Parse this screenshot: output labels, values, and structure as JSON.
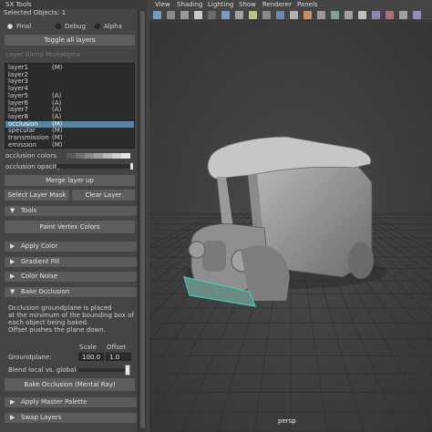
{
  "window": {
    "title": "SX Tools",
    "selected_objects": "Selected Objects: 1"
  },
  "shading_mode": {
    "options": [
      "Final",
      "Debug",
      "Alpha"
    ],
    "selected": "Final"
  },
  "toggle_all_layers": "Toggle all layers",
  "layer_blend_mode": {
    "label": "Layer Blend Mode",
    "value": "Alpha"
  },
  "layers": [
    {
      "name": "layer1",
      "flag": "(M)"
    },
    {
      "name": "layer2",
      "flag": ""
    },
    {
      "name": "layer3",
      "flag": ""
    },
    {
      "name": "layer4",
      "flag": ""
    },
    {
      "name": "layer5",
      "flag": "(A)"
    },
    {
      "name": "layer6",
      "flag": "(A)"
    },
    {
      "name": "layer7",
      "flag": "(A)"
    },
    {
      "name": "layer8",
      "flag": "(A)"
    },
    {
      "name": "occlusion",
      "flag": "(M)"
    },
    {
      "name": "specular",
      "flag": "(M)"
    },
    {
      "name": "transmission",
      "flag": "(M)"
    },
    {
      "name": "emission",
      "flag": "(M)"
    }
  ],
  "selected_layer": "occlusion",
  "occlusion_colors": {
    "label": "occlusion colors:",
    "swatches": [
      "#444444",
      "#5a5a5a",
      "#707070",
      "#888888",
      "#a0a0a0",
      "#b8b8b8",
      "#d0d0d0",
      "#e8e8e8"
    ]
  },
  "occlusion_opacity": {
    "label": "occlusion opacity:",
    "value": 1.0
  },
  "buttons": {
    "merge_layer_up": "Merge layer up",
    "select_layer_mask": "Select Layer Mask",
    "clear_layer": "Clear Layer",
    "paint_vertex_colors": "Paint Vertex Colors",
    "bake_occlusion": "Bake Occlusion (Mental Ray)"
  },
  "sections": {
    "tools": "Tools",
    "apply_color": "Apply Color",
    "gradient_fill": "Gradient Fill",
    "color_noise": "Color Noise",
    "bake_occlusion": "Bake Occlusion",
    "apply_master_palette": "Apply Master Palette",
    "swap_layers": "Swap Layers"
  },
  "bake_help": [
    "Occlusion groundplane is placed",
    "at the minimum of the bounding box of",
    "each object being baked.",
    "Offset pushes the plane down."
  ],
  "groundplane": {
    "label": "Groundplane:",
    "scale_header": "Scale",
    "offset_header": "Offset",
    "scale": "100.0",
    "offset": "1.0"
  },
  "blend": {
    "label": "Blend local vs. global",
    "value": 1.0
  },
  "viewport": {
    "menus": [
      "View",
      "Shading",
      "Lighting",
      "Show",
      "Renderer",
      "Panels"
    ],
    "camera": "persp"
  },
  "colors": {
    "accent": "#5285a6",
    "panel": "#444444",
    "viewport_bg": "#3e3e3e"
  }
}
